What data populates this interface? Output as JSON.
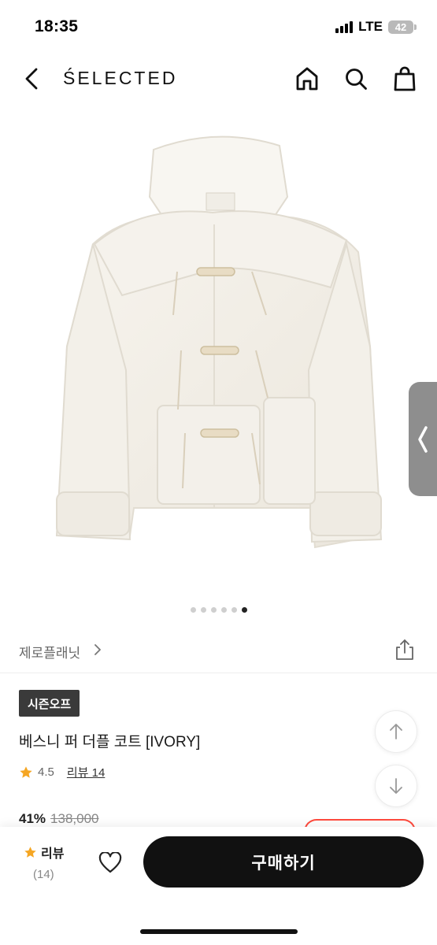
{
  "status_bar": {
    "time": "18:35",
    "network": "LTE",
    "battery": "42"
  },
  "nav": {
    "logo": "ŚELECTED",
    "icons": [
      "back-icon",
      "home-icon",
      "search-icon",
      "shopping-bag-icon"
    ]
  },
  "gallery": {
    "image": "ivory-fur-duffle-coat",
    "page_count": 6,
    "active_index": 5
  },
  "brand": {
    "name": "제로플래닛"
  },
  "product": {
    "badge": "시즌오프",
    "title": "베스니 퍼 더플 코트 [IVORY]",
    "rating": "4.5",
    "review_link": "리뷰 14",
    "discount": "41%",
    "original_price": "138,000"
  },
  "bottom_bar": {
    "review_label": "리뷰",
    "review_count": "(14)",
    "buy_label": "구매하기"
  },
  "colors": {
    "accent": "#111111",
    "star": "#f5a623",
    "coupon_border": "#ff4a3d",
    "badge_bg": "#3a3a3a"
  }
}
